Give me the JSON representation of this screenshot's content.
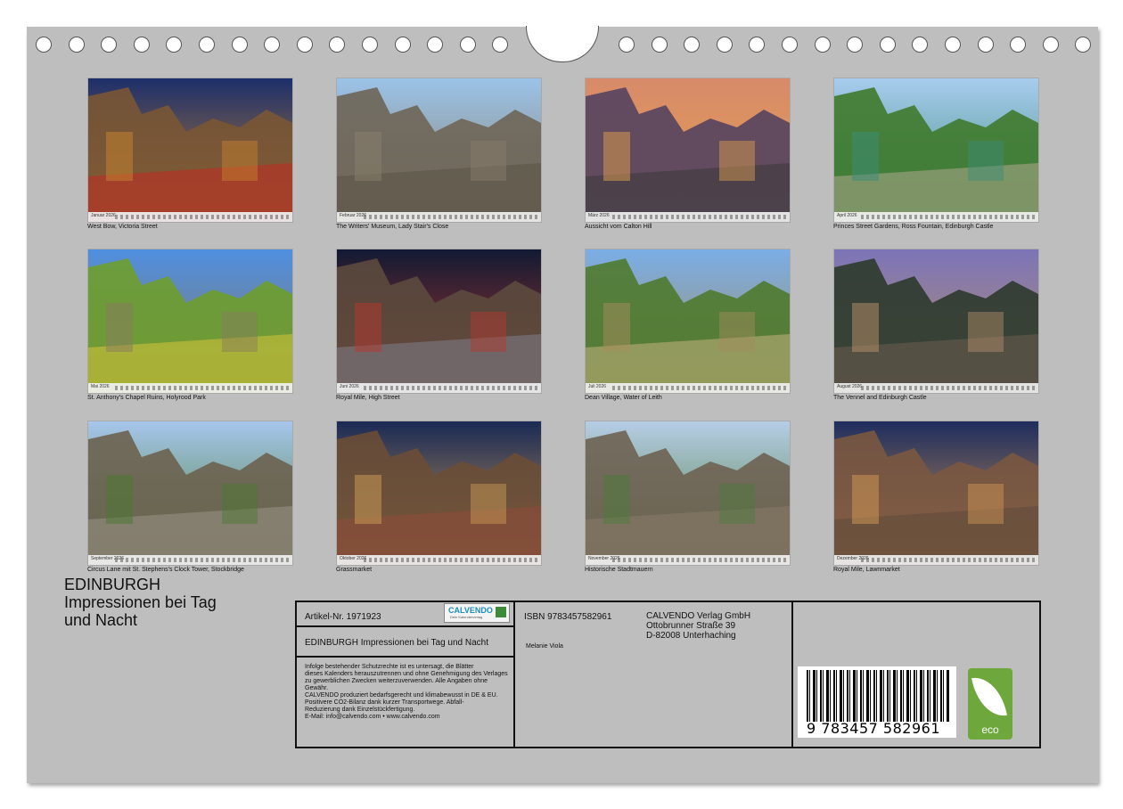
{
  "photos": [
    {
      "caption": "West Bow, Victoria Street",
      "month": "Januar 2026",
      "palette": [
        "#1c2f6b",
        "#7a5634",
        "#c9852e",
        "#c22a20"
      ]
    },
    {
      "caption": "The Writers' Museum, Lady Stair's Close",
      "month": "Februar 2026",
      "palette": [
        "#9bc3e8",
        "#6e6556",
        "#8a7f6c",
        "#5a5347"
      ]
    },
    {
      "caption": "Aussicht vom Calton Hill",
      "month": "März 2026",
      "palette": [
        "#d88a6a",
        "#54425f",
        "#e2a24c",
        "#3b3a3c"
      ]
    },
    {
      "caption": "Princes Street Gardens, Ross Fountain, Edinburgh Castle",
      "month": "April 2026",
      "palette": [
        "#a8ccee",
        "#3f7a2c",
        "#3a8c7a",
        "#b0a88e"
      ]
    },
    {
      "caption": "St. Anthony's Chapel Ruins, Holyrood Park",
      "month": "Mai 2026",
      "palette": [
        "#4f8fe0",
        "#6e9d2c",
        "#8a7a60",
        "#d7c23a"
      ]
    },
    {
      "caption": "Royal Mile, High Street",
      "month": "Juni 2026",
      "palette": [
        "#111a33",
        "#5c4a3d",
        "#b8382e",
        "#7d7f8c"
      ]
    },
    {
      "caption": "Dean Village, Water of Leith",
      "month": "Juli 2026",
      "palette": [
        "#7aaee6",
        "#4f7a2e",
        "#a78c5e",
        "#c7b27e"
      ]
    },
    {
      "caption": "The Vennel and Edinburgh Castle",
      "month": "August 2026",
      "palette": [
        "#7c74b8",
        "#2c3a2c",
        "#b9916a",
        "#6c5c50"
      ]
    },
    {
      "caption": "Circus Lane mit St. Stephens's Clock Tower, Stockbridge",
      "month": "September 2026",
      "palette": [
        "#a6c6ec",
        "#6c624f",
        "#4a7a2e",
        "#9b9488"
      ]
    },
    {
      "caption": "Grassmarket",
      "month": "Oktober 2026",
      "palette": [
        "#1a2a55",
        "#6a4e36",
        "#d0a058",
        "#8f4a3a"
      ]
    },
    {
      "caption": "Historische Stadtmauern",
      "month": "November 2026",
      "palette": [
        "#b6cde6",
        "#6e6252",
        "#4c7c3a",
        "#8a7c6a"
      ]
    },
    {
      "caption": "Royal Mile, Lawnmarket",
      "month": "Dezember 2026",
      "palette": [
        "#1e2d5e",
        "#7a5840",
        "#d49a56",
        "#5c4a3a"
      ]
    }
  ],
  "title": {
    "line1": "EDINBURGH",
    "line2": "Impressionen bei Tag",
    "line3": "und Nacht"
  },
  "info": {
    "article": "Artikel-Nr. 1971923",
    "logo": "CALVENDO",
    "logo_sub": "Dein Kalenderverlag",
    "product_title": "EDINBURGH Impressionen bei Tag und Nacht",
    "legal": [
      "Infolge bestehender Schutzrechte ist es untersagt, die Blätter",
      "dieses Kalenders herauszutrennen und ohne Genehmigung des Verlages",
      "zu gewerblichen Zwecken weiterzuverwenden. Alle Angaben ohne",
      "Gewähr.",
      "CALVENDO produziert bedarfsgerecht und klimabewusst in DE & EU.",
      "Positivere CO2-Bilanz dank kurzer Transportwege. Abfall-",
      "Reduzierung dank Einzelstückfertigung.",
      "E-Mail: info@calvendo.com • www.calvendo.com"
    ],
    "isbn": "ISBN 9783457582961",
    "author": "Melanie Viola",
    "publisher": [
      "CALVENDO Verlag GmbH",
      "Ottobrunner Straße 39",
      "D-82008 Unterhaching"
    ],
    "barcode_number": "9 783457 582961",
    "eco_label": "eco"
  }
}
